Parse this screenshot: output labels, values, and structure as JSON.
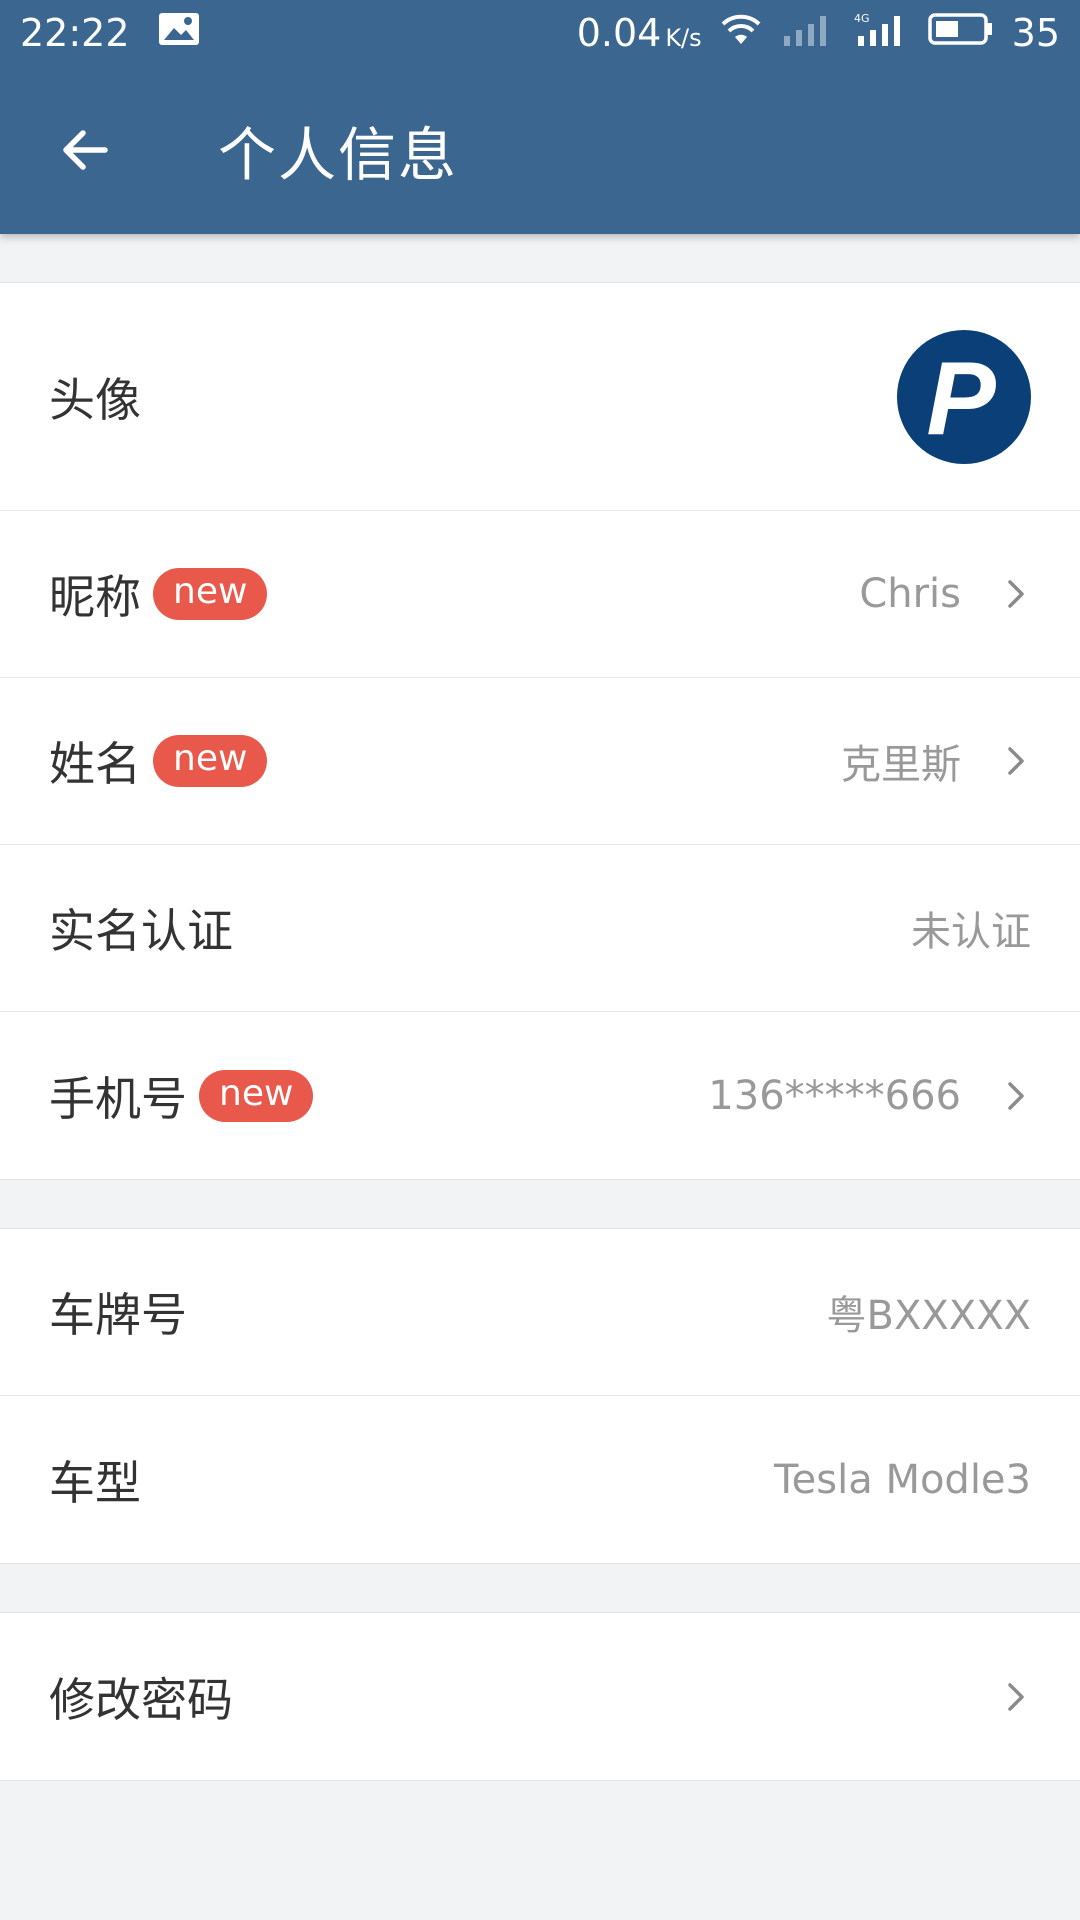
{
  "status_bar": {
    "time": "22:22",
    "net_speed": "0.04",
    "net_unit": "K/s",
    "network_type": "4G",
    "battery": "35"
  },
  "app_bar": {
    "title": "个人信息"
  },
  "profile": {
    "avatar": {
      "label": "头像",
      "avatar_letter": "P",
      "avatar_color": "#0a3f78"
    },
    "nickname": {
      "label": "昵称",
      "badge": "new",
      "value": "Chris"
    },
    "name": {
      "label": "姓名",
      "badge": "new",
      "value": "克里斯"
    },
    "verification": {
      "label": "实名认证",
      "value": "未认证"
    },
    "phone": {
      "label": "手机号",
      "badge": "new",
      "value": "136*****666"
    }
  },
  "vehicle": {
    "plate": {
      "label": "车牌号",
      "value": "粤BXXXXX"
    },
    "model": {
      "label": "车型",
      "value": "Tesla Modle3"
    }
  },
  "security": {
    "password": {
      "label": "修改密码"
    }
  },
  "colors": {
    "header": "#3a6690",
    "badge": "#e8584b",
    "background": "#f2f3f5"
  }
}
